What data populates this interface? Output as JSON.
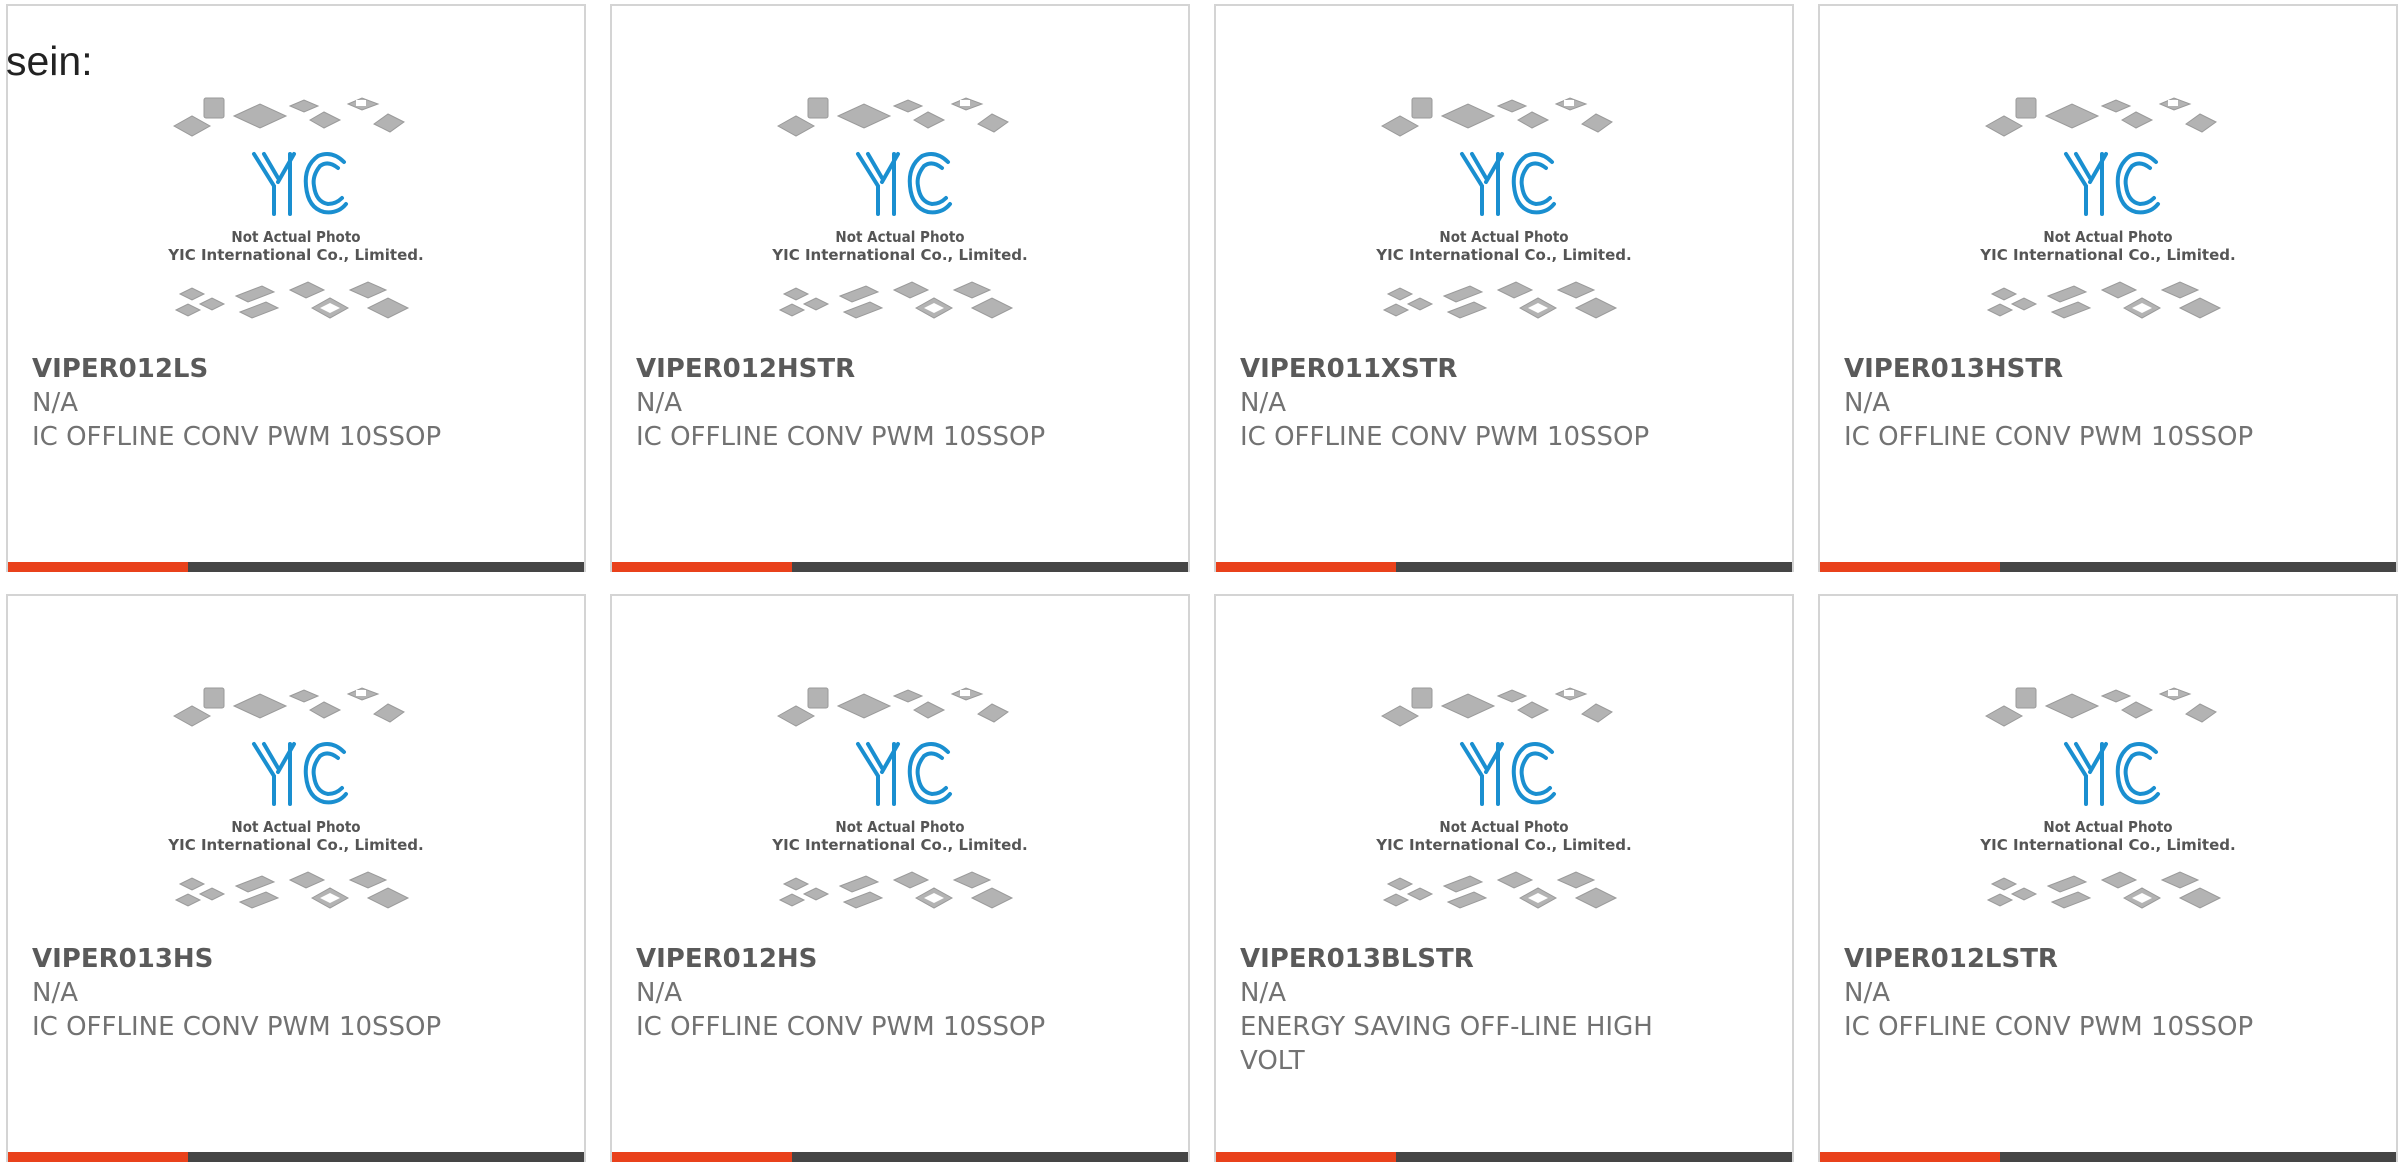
{
  "heading": "sein:",
  "image_caption": {
    "line1": "Not Actual Photo",
    "line2": "YIC International Co., Limited.",
    "logo_text": "YIC"
  },
  "colors": {
    "accent_bar": "#e9411b",
    "dark_bar": "#454545",
    "border": "#d4d4d4",
    "logo": "#1a8fd0",
    "chip_gray": "#b3b3b3"
  },
  "products": [
    {
      "part_number": "VIPER012LS",
      "manufacturer": "N/A",
      "description": "IC OFFLINE CONV PWM 10SSOP"
    },
    {
      "part_number": "VIPER012HSTR",
      "manufacturer": "N/A",
      "description": "IC OFFLINE CONV PWM 10SSOP"
    },
    {
      "part_number": "VIPER011XSTR",
      "manufacturer": "N/A",
      "description": "IC OFFLINE CONV PWM 10SSOP"
    },
    {
      "part_number": "VIPER013HSTR",
      "manufacturer": "N/A",
      "description": "IC OFFLINE CONV PWM 10SSOP"
    },
    {
      "part_number": "VIPER013HS",
      "manufacturer": "N/A",
      "description": "IC OFFLINE CONV PWM 10SSOP"
    },
    {
      "part_number": "VIPER012HS",
      "manufacturer": "N/A",
      "description": "IC OFFLINE CONV PWM 10SSOP"
    },
    {
      "part_number": "VIPER013BLSTR",
      "manufacturer": "N/A",
      "description": "ENERGY SAVING OFF-LINE HIGH VOLT"
    },
    {
      "part_number": "VIPER012LSTR",
      "manufacturer": "N/A",
      "description": "IC OFFLINE CONV PWM 10SSOP"
    }
  ]
}
